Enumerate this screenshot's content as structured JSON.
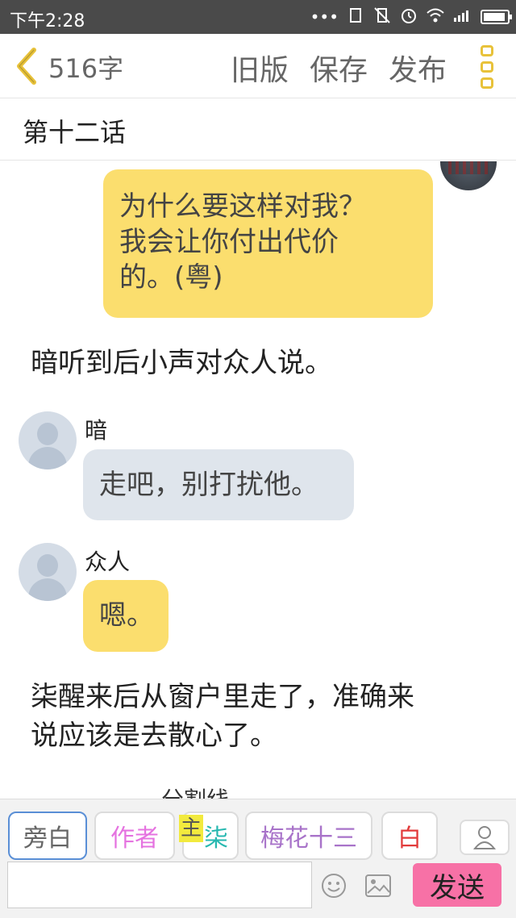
{
  "status_bar": {
    "time": "下午2:28",
    "icons": [
      "dots-icon",
      "screen-rotate-icon",
      "vibrate-off-icon",
      "alarm-icon",
      "wifi-icon",
      "signal-icon",
      "battery-icon"
    ]
  },
  "top_bar": {
    "word_count": "516字",
    "old_version": "旧版",
    "save": "保存",
    "publish": "发布"
  },
  "chapter": {
    "title": "第十二话"
  },
  "messages": {
    "top_bubble": {
      "lines": [
        "为什么要这样对我？",
        "我会让你付出代价",
        "的。(粤)"
      ]
    },
    "narration1": "暗听到后小声对众人说。",
    "m1": {
      "speaker": "暗",
      "text": "走吧，别打扰他。"
    },
    "m2": {
      "speaker": "众人",
      "text": "嗯。"
    },
    "narration2": {
      "lines": [
        "柒醒来后从窗户里走了，准确来",
        "说应该是去散心了。"
      ]
    },
    "partial": "分割线"
  },
  "characters": {
    "items": [
      "旁白",
      "作者",
      "柒",
      "梅花十三",
      "白"
    ],
    "colors": [
      "#666666",
      "#e573e0",
      "#27b8b0",
      "#a873c9",
      "#e23b3b"
    ],
    "main_label": "主"
  },
  "input": {
    "send": "发送",
    "emoji_icon": "smiley-icon",
    "image_icon": "image-icon"
  }
}
